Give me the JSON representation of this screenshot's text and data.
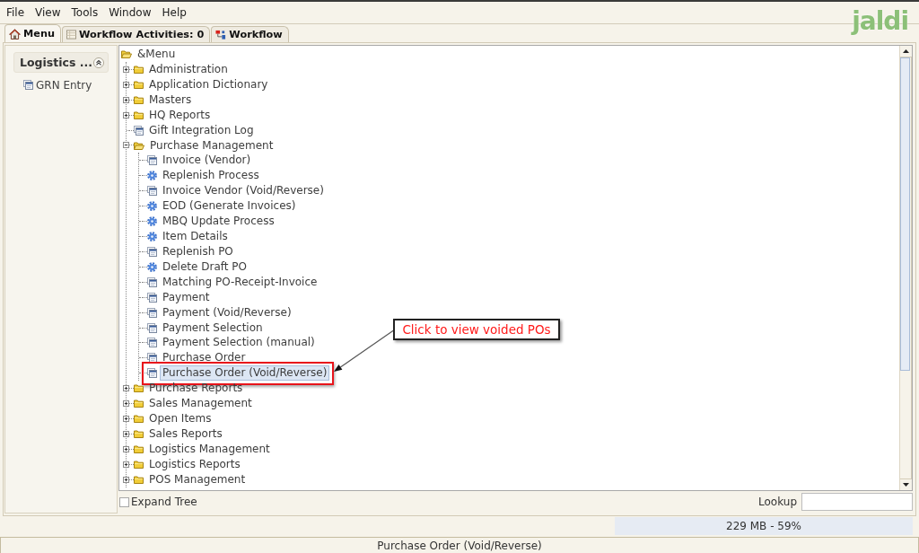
{
  "menu_bar": [
    "File",
    "View",
    "Tools",
    "Window",
    "Help"
  ],
  "logo": "jaldi",
  "tabs": [
    {
      "label": "Menu",
      "selected": true
    },
    {
      "label": "Workflow Activities: 0",
      "selected": false
    },
    {
      "label": "Workflow",
      "selected": false
    }
  ],
  "favorites": {
    "title": "Logistics ...",
    "expanded": true,
    "items": [
      {
        "label": "GRN Entry",
        "kind": "window"
      }
    ]
  },
  "tree": {
    "label": "&Menu",
    "kind": "folder",
    "expanded": true,
    "selected": false,
    "children": [
      {
        "label": "Administration",
        "kind": "folder",
        "expanded": false,
        "selected": false
      },
      {
        "label": "Application Dictionary",
        "kind": "folder",
        "expanded": false,
        "selected": false
      },
      {
        "label": "Masters",
        "kind": "folder",
        "expanded": false,
        "selected": false
      },
      {
        "label": "HQ Reports",
        "kind": "folder",
        "expanded": false,
        "selected": false
      },
      {
        "label": "Gift Integration Log",
        "kind": "window",
        "selected": false
      },
      {
        "label": "Purchase Management",
        "kind": "folder",
        "expanded": true,
        "selected": false,
        "children": [
          {
            "label": "Invoice (Vendor)",
            "kind": "window",
            "selected": false
          },
          {
            "label": "Replenish Process",
            "kind": "process",
            "selected": false
          },
          {
            "label": "Invoice Vendor (Void/Reverse)",
            "kind": "window",
            "selected": false
          },
          {
            "label": "EOD (Generate Invoices)",
            "kind": "process",
            "selected": false
          },
          {
            "label": "MBQ Update Process",
            "kind": "process",
            "selected": false
          },
          {
            "label": "Item Details",
            "kind": "process",
            "selected": false
          },
          {
            "label": "Replenish PO",
            "kind": "window",
            "selected": false
          },
          {
            "label": "Delete Draft PO",
            "kind": "process",
            "selected": false
          },
          {
            "label": "Matching PO-Receipt-Invoice",
            "kind": "window",
            "selected": false
          },
          {
            "label": "Payment",
            "kind": "window",
            "selected": false
          },
          {
            "label": "Payment (Void/Reverse)",
            "kind": "window",
            "selected": false
          },
          {
            "label": "Payment Selection",
            "kind": "window",
            "selected": false
          },
          {
            "label": "Payment Selection (manual)",
            "kind": "window",
            "selected": false
          },
          {
            "label": "Purchase Order",
            "kind": "window",
            "selected": false
          },
          {
            "label": "Purchase Order (Void/Reverse)",
            "kind": "window",
            "selected": true
          }
        ]
      },
      {
        "label": "Purchase Reports",
        "kind": "folder",
        "expanded": false,
        "selected": false
      },
      {
        "label": "Sales Management",
        "kind": "folder",
        "expanded": false,
        "selected": false
      },
      {
        "label": "Open Items",
        "kind": "folder",
        "expanded": false,
        "selected": false
      },
      {
        "label": "Sales Reports",
        "kind": "folder",
        "expanded": false,
        "selected": false
      },
      {
        "label": "Logistics Management",
        "kind": "folder",
        "expanded": false,
        "selected": false
      },
      {
        "label": "Logistics Reports",
        "kind": "folder",
        "expanded": false,
        "selected": false
      },
      {
        "label": "POS Management",
        "kind": "folder",
        "expanded": false,
        "selected": false
      }
    ]
  },
  "annotation": {
    "text": "Click to view voided POs"
  },
  "expand_tree": {
    "label": "Expand Tree",
    "checked": false
  },
  "lookup": {
    "label": "Lookup"
  },
  "memory": "229 MB - 59%",
  "status_bar": "Purchase Order (Void/Reverse)"
}
